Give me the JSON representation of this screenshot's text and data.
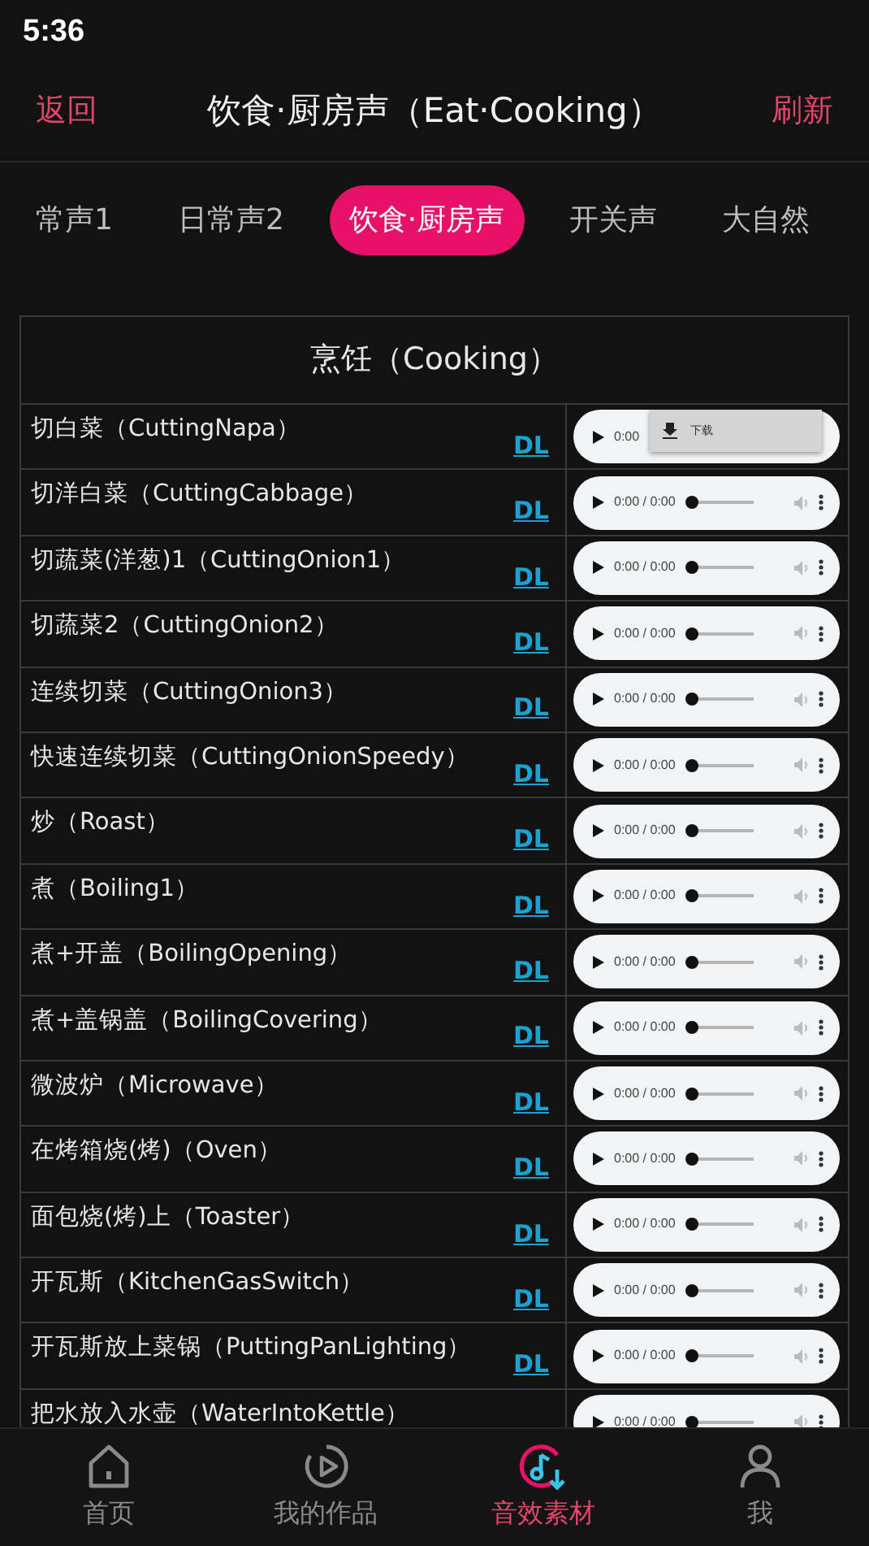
{
  "status_bar": {
    "time": "5:36"
  },
  "header": {
    "back": "返回",
    "title": "饮食·厨房声（Eat·Cooking）",
    "refresh": "刷新"
  },
  "tabs": [
    {
      "label": "常声1",
      "selected": false
    },
    {
      "label": "日常声2",
      "selected": false
    },
    {
      "label": "饮食·厨房声",
      "selected": true
    },
    {
      "label": "开关声",
      "selected": false
    },
    {
      "label": "大自然",
      "selected": false
    }
  ],
  "table": {
    "title": "烹饪（Cooking）",
    "rows": [
      {
        "name": "切白菜（CuttingNapa）",
        "link": "DL",
        "time": "0:00",
        "menu": {
          "label": "下载"
        }
      },
      {
        "name": "切洋白菜（CuttingCabbage）",
        "link": "DL",
        "time": "0:00 / 0:00",
        "level": 0
      },
      {
        "name": "切蔬菜(洋葱)1（CuttingOnion1）",
        "link": "DL",
        "time": "0:00 / 0:00",
        "level": 0
      },
      {
        "name": "切蔬菜2（CuttingOnion2）",
        "link": "DL",
        "time": "0:00 / 0:00",
        "level": 0
      },
      {
        "name": "连续切菜（CuttingOnion3）",
        "link": "DL",
        "time": "0:00 / 0:00",
        "level": 0
      },
      {
        "name": "快速连续切菜（CuttingOnionSpeedy）",
        "link": "DL",
        "time": "0:00 / 0:00",
        "level": 0
      },
      {
        "name": "炒（Roast）",
        "link": "DL",
        "time": "0:00 / 0:00",
        "level": 0
      },
      {
        "name": "煮（Boiling1）",
        "link": "DL",
        "time": "0:00 / 0:00",
        "level": 0
      },
      {
        "name": "煮+开盖（BoilingOpening）",
        "link": "DL",
        "time": "0:00 / 0:00",
        "level": 0
      },
      {
        "name": "煮+盖锅盖（BoilingCovering）",
        "link": "DL",
        "time": "0:00 / 0:00",
        "level": 0
      },
      {
        "name": "微波炉（Microwave）",
        "link": "DL",
        "time": "0:00 / 0:00",
        "level": 0
      },
      {
        "name": "在烤箱烧(烤)（Oven）",
        "link": "DL",
        "time": "0:00 / 0:00",
        "level": 0
      },
      {
        "name": "面包烧(烤)上（Toaster）",
        "link": "DL",
        "time": "0:00 / 0:00",
        "level": 0
      },
      {
        "name": "开瓦斯（KitchenGasSwitch）",
        "link": "DL",
        "time": "0:00 / 0:00",
        "level": 0
      },
      {
        "name": "开瓦斯放上菜锅（PuttingPanLighting）",
        "link": "DL",
        "time": "0:00 / 0:00",
        "level": 0
      },
      {
        "name": "把水放入水壶（WaterIntoKettle）",
        "time": "0:00 / 0:00",
        "level": 0
      }
    ]
  },
  "bottom_nav": [
    {
      "label": "首页",
      "selected": false
    },
    {
      "label": "我的作品",
      "selected": false
    },
    {
      "label": "音效素材",
      "selected": true
    },
    {
      "label": "我",
      "selected": false
    }
  ]
}
